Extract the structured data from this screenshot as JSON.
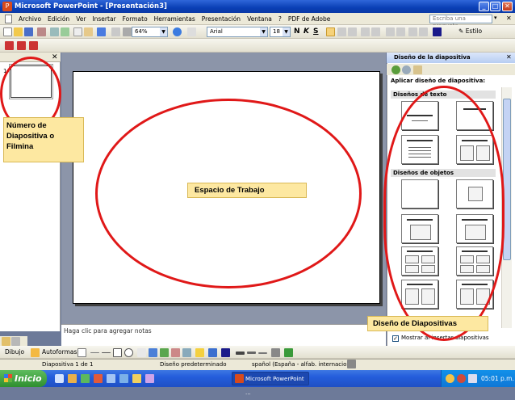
{
  "window": {
    "title": "Microsoft PowerPoint - [Presentación3]",
    "buttons": [
      "_",
      "□",
      "✕"
    ]
  },
  "menu": {
    "items": [
      "Archivo",
      "Edición",
      "Ver",
      "Insertar",
      "Formato",
      "Herramientas",
      "Presentación",
      "Ventana",
      "?",
      "PDF de Adobe"
    ],
    "help_placeholder": "Escriba una pregunta",
    "close": "✕"
  },
  "toolbar_standard": {
    "zoom": "64%",
    "font": "Arial",
    "size": "18",
    "bold": "N",
    "italic": "K",
    "underline": "S",
    "design_button": "Estilo"
  },
  "outline_pane": {
    "close": "✕",
    "slide_number": "1"
  },
  "notes": {
    "placeholder": "Haga clic para agregar notas"
  },
  "task_pane": {
    "title": "Diseño de la diapositiva",
    "close": "✕",
    "apply_label": "Aplicar diseño de diapositiva:",
    "section_text": "Diseños de texto",
    "section_objects": "Diseños de objetos",
    "show_label": "Mostrar al insertar diapositivas"
  },
  "drawing_toolbar": {
    "draw": "Dibujo",
    "autoshapes": "Autoformas"
  },
  "status_bar": {
    "slide": "Diapositiva 1 de 1",
    "design": "Diseño predeterminado",
    "language": "spañol (España - alfab. internacional"
  },
  "taskbar": {
    "start": "Inicio",
    "app_button": "Microsoft PowerPoint ...",
    "clock": "05:01 p.m."
  },
  "annotations": {
    "slide_number": "Número de Diapositiva o Filmina",
    "workspace": "Espacio de Trabajo",
    "design": "Diseño de Diapositivas"
  },
  "colors": {
    "annotation_fill": "#fde8a1",
    "ring": "#e01818",
    "title_bar": "#0a3fb5"
  }
}
